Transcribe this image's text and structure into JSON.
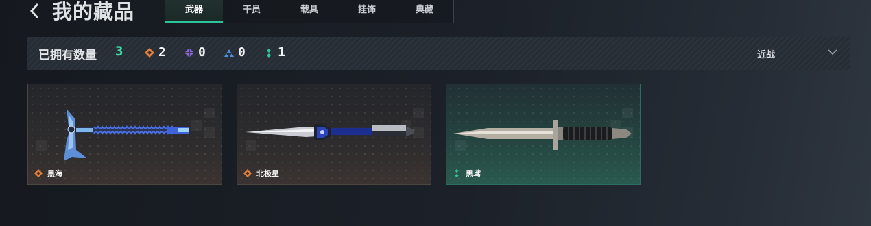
{
  "header": {
    "title": "我的藏品",
    "tabs": [
      {
        "label": "武器",
        "active": true
      },
      {
        "label": "干员",
        "active": false
      },
      {
        "label": "载具",
        "active": false
      },
      {
        "label": "挂饰",
        "active": false
      },
      {
        "label": "典藏",
        "active": false
      }
    ]
  },
  "stats": {
    "owned_label": "已拥有数量",
    "owned_total": "3",
    "rarity_counts": [
      {
        "icon": "orange-diamond-icon",
        "color": "#e0803a",
        "count": "2"
      },
      {
        "icon": "purple-diamond-icon",
        "color": "#8a63d6",
        "count": "0"
      },
      {
        "icon": "blue-triangle-icon",
        "color": "#4c8fe0",
        "count": "0"
      },
      {
        "icon": "green-dots-icon",
        "color": "#2fc79a",
        "count": "1"
      }
    ],
    "filter_value": "近战"
  },
  "items": [
    {
      "name": "黑海",
      "rarity_icon": "orange-diamond-icon",
      "theme": "brown"
    },
    {
      "name": "北极星",
      "rarity_icon": "orange-diamond-icon",
      "theme": "brown"
    },
    {
      "name": "黑鸢",
      "rarity_icon": "green-dots-icon",
      "theme": "green"
    }
  ],
  "colors": {
    "accent_green": "#3fe0a6",
    "rarity_orange": "#e0803a",
    "rarity_purple": "#8a63d6",
    "rarity_blue": "#4c8fe0",
    "rarity_green": "#2fc79a"
  }
}
